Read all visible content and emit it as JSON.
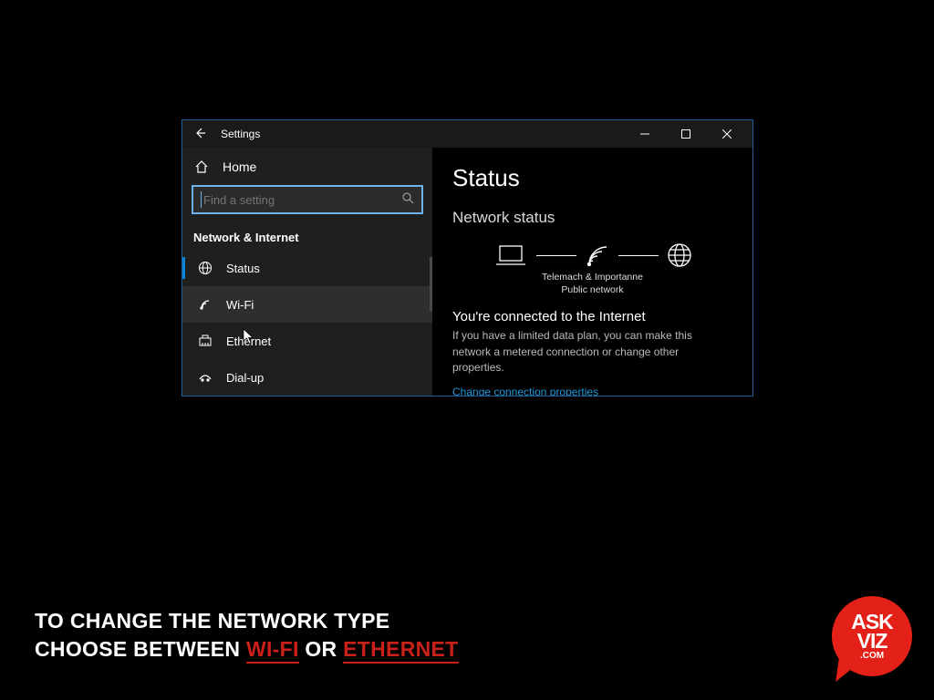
{
  "window": {
    "title": "Settings",
    "controls": {
      "min": "minimize",
      "max": "maximize",
      "close": "close"
    }
  },
  "sidebar": {
    "home_label": "Home",
    "search_placeholder": "Find a setting",
    "section_title": "Network & Internet",
    "items": [
      {
        "id": "status",
        "label": "Status",
        "selected": true,
        "hover": false
      },
      {
        "id": "wifi",
        "label": "Wi-Fi",
        "selected": false,
        "hover": true
      },
      {
        "id": "ethernet",
        "label": "Ethernet",
        "selected": false,
        "hover": false
      },
      {
        "id": "dialup",
        "label": "Dial-up",
        "selected": false,
        "hover": false
      }
    ]
  },
  "content": {
    "heading": "Status",
    "subheading": "Network status",
    "diagram": {
      "ssid": "Telemach & Importanne",
      "network_type": "Public network"
    },
    "connected_title": "You're connected to the Internet",
    "connected_body": "If you have a limited data plan, you can make this network a metered connection or change other properties.",
    "link": "Change connection properties"
  },
  "caption": {
    "line1": "TO CHANGE THE NETWORK TYPE",
    "line2_a": "CHOOSE BETWEEN ",
    "line2_b": "WI-FI",
    "line2_c": " OR ",
    "line2_d": "ETHERNET"
  },
  "logo": {
    "l1": "ASK",
    "l2": "VIZ",
    "dotcom": ".COM"
  },
  "colors": {
    "accent_red": "#c9201a",
    "link_blue": "#2196d8",
    "window_border": "#195f9c"
  }
}
